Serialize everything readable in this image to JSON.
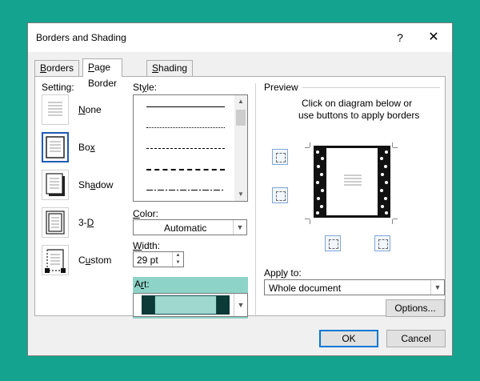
{
  "dialog": {
    "title": "Borders and Shading",
    "help_label": "?",
    "close_label": "✕"
  },
  "tabs": [
    {
      "label": "Borders",
      "accel": "B",
      "rest": "orders",
      "active": false
    },
    {
      "label": "Page Border",
      "accel": "P",
      "rest": "age Border",
      "active": true
    },
    {
      "label": "Shading",
      "accel": "S",
      "rest": "hading",
      "active": false
    }
  ],
  "setting": {
    "label": "Setting:",
    "items": [
      {
        "label": "None",
        "accel": "N",
        "rest": "one",
        "selected": false
      },
      {
        "label": "Box",
        "accel": "x",
        "pre": "Bo",
        "selected": true
      },
      {
        "label": "Shadow",
        "accel": "a",
        "pre": "Sh",
        "post": "dow",
        "selected": false
      },
      {
        "label": "3-D",
        "accel": "D",
        "pre": "3-",
        "selected": false
      },
      {
        "label": "Custom",
        "accel": "u",
        "pre": "C",
        "post": "stom",
        "selected": false
      }
    ]
  },
  "style": {
    "label": "Style:",
    "accel": "y",
    "pre": "St",
    "post": "le:"
  },
  "color": {
    "label": "Color:",
    "accel": "C",
    "rest": "olor:",
    "value": "Automatic"
  },
  "width": {
    "label": "Width:",
    "accel": "W",
    "rest": "idth:",
    "value": "29 pt"
  },
  "art": {
    "label": "Art:",
    "accel": "r",
    "pre": "A",
    "post": "t:"
  },
  "preview": {
    "label": "Preview",
    "instruction_line1": "Click on diagram below or",
    "instruction_line2": "use buttons to apply borders"
  },
  "apply_to": {
    "label": "Apply to:",
    "accel": "l",
    "pre": "App",
    "post": "y to:",
    "value": "Whole document"
  },
  "buttons": {
    "options": "Options...",
    "ok": "OK",
    "cancel": "Cancel"
  },
  "colors": {
    "background": "#14a38e",
    "accent": "#0078d7",
    "art_highlight": "#8ed3c8"
  }
}
